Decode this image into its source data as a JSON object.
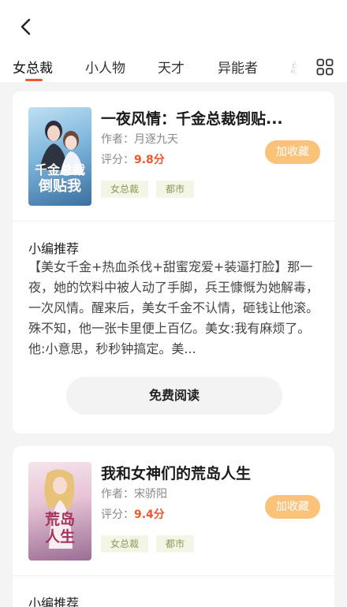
{
  "tabs": [
    "女总裁",
    "小人物",
    "天才",
    "异能者",
    "总"
  ],
  "books": [
    {
      "title": "一夜风情：千金总裁倒贴...",
      "author": "作者：月逐九天",
      "score_label": "评分：",
      "score": "9.8分",
      "tags": [
        "女总裁",
        "都市"
      ],
      "collect_label": "加收藏",
      "cover": {
        "line1": "千金总裁",
        "line2": "倒贴我",
        "colors": [
          "#7fb6dd",
          "#3b6f9e"
        ]
      },
      "rec_heading": "小编推荐",
      "rec_text": "【美女千金+热血杀伐+甜蜜宠爱+装逼打脸】那一夜，她的饮料中被人动了手脚，兵王慷慨为她解毒，一次风情。醒来后，美女千金不认情，砸钱让他滚。殊不知，他一张卡里便上百亿。美女:我有麻烦了。他:小意思，秒秒钟搞定。美...",
      "read_label": "免费阅读"
    },
    {
      "title": "我和女神们的荒岛人生",
      "author": "作者：宋骄阳",
      "score_label": "评分：",
      "score": "9.4分",
      "tags": [
        "女总裁",
        "都市"
      ],
      "collect_label": "加收藏",
      "cover": {
        "line1": "荒岛",
        "line2": "人生",
        "colors": [
          "#e7c4d6",
          "#9b6e95"
        ]
      },
      "rec_heading": "小编推荐"
    }
  ],
  "colors": {
    "accent": "#f0562a",
    "collect": "#fbc27a",
    "tag_text": "#8a9a57",
    "tag_bg": "#f3f5e7"
  }
}
